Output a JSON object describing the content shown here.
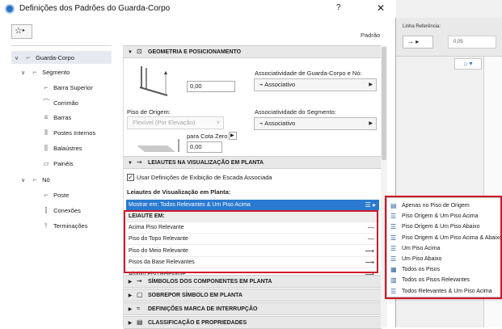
{
  "window": {
    "title": "Definições dos Padrões do Guarda-Corpo",
    "help": "?",
    "close": "✕"
  },
  "toolbar": {
    "favorites_icon": "☆",
    "favorites_arrow": "▸",
    "preset_label": "Padrão"
  },
  "background_app": {
    "label": "Linha Referência:",
    "arrow_value": "→ ▸",
    "value": "0,05"
  },
  "tree": [
    {
      "label": "Guarda-Corpo",
      "chev": "∨",
      "icon": "rail-icon",
      "selected": true
    },
    {
      "label": "Segmento",
      "chev": "∨",
      "icon": "segment-icon"
    },
    {
      "label": "Barra Superior",
      "icon": "top-rail-icon"
    },
    {
      "label": "Corrimão",
      "icon": "handrail-icon"
    },
    {
      "label": "Barras",
      "icon": "rails-icon"
    },
    {
      "label": "Postes Internos",
      "icon": "inner-posts-icon"
    },
    {
      "label": "Balaústres",
      "icon": "balusters-icon"
    },
    {
      "label": "Painéis",
      "icon": "panels-icon"
    },
    {
      "label": "Nó",
      "chev": "∨",
      "icon": "node-icon"
    },
    {
      "label": "Poste",
      "icon": "post-icon"
    },
    {
      "label": "Conexões",
      "icon": "connections-icon"
    },
    {
      "label": "Terminações",
      "icon": "terminations-icon"
    }
  ],
  "geometry": {
    "header": "GEOMETRIA E POSICIONAMENTO",
    "height_value": "0,00",
    "assoc_rail_label": "Associatividade de Guarda-Corpo e Nó:",
    "assoc_rail_value": "Associativo",
    "origin_label": "Piso de Origem:",
    "origin_value": "Flexível (Por Elevação)",
    "assoc_segment_label": "Associatividade do Segmento:",
    "assoc_segment_value": "Associativo",
    "cota_label": "para Cota Zero",
    "cota_value": "0,00"
  },
  "layouts": {
    "header": "LEIAUTES NA VISUALIZAÇÃO EM PLANTA",
    "checkbox_label": "Usar Definições de Exibição de Escada Associada",
    "checked": true,
    "section_label": "Leiautes de Visualização em Planta:",
    "show_row": "Mostrar em: Todos Relevantes & Um Piso Acima",
    "table_header": "LEIAUTE EM:",
    "rows": [
      "Acima Piso Relevante",
      "Piso do Topo Relevante",
      "Piso do Meio Relevante",
      "Pisos da Base Relevantes",
      "Abaixo Piso Relevante"
    ]
  },
  "sections": [
    "SÍMBOLOS DOS COMPONENTES EM PLANTA",
    "SOBREPOR SÍMBOLO EM PLANTA",
    "DEFINIÇÕES MARCA DE INTERRUPÇÃO",
    "CLASSIFICAÇÃO E PROPRIEDADES"
  ],
  "popup": [
    "Apenas no Piso de Origem",
    "Piso Origem & Um Piso Acima",
    "Piso Origem & Um Piso Abaixo",
    "Piso Origem & Um Piso Acima & Abaixo",
    "Um Piso Acima",
    "Um Piso Abaixo",
    "Todos os Pisos",
    "Todos os Pisos Relevantes",
    "Todos Relevantes & Um Piso Acima"
  ],
  "colors": {
    "accent": "#2a7ad1",
    "highlight_box": "#d11a2a"
  }
}
